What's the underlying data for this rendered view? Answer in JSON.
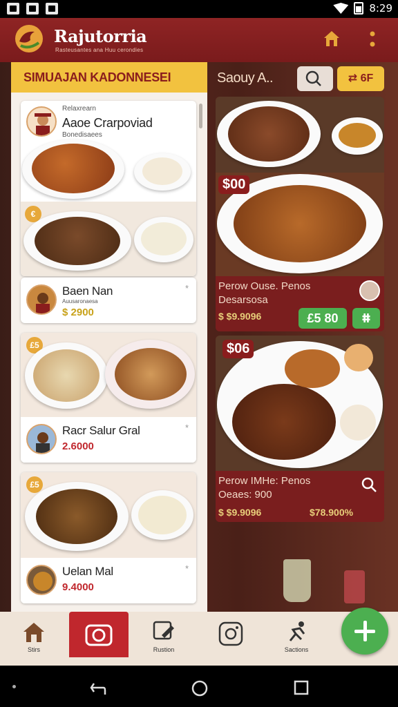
{
  "status": {
    "time": "8:29"
  },
  "app": {
    "title": "Rajutorria",
    "subtitle": "Rasteusantes ana Huu cerondies"
  },
  "left": {
    "header": "SIMUAJAN KADONNESEI",
    "cards": [
      {
        "tag": "Relaxrearn",
        "name": "Aaoe Crarpoviad",
        "desc": "Bonedisaees"
      },
      {
        "name": "Baen Nan",
        "desc": "Auusaronaesa",
        "price": "$ 2900",
        "badge": "€"
      },
      {
        "name": "Racr Salur Gral",
        "price": "2.6000",
        "badge": "£5"
      },
      {
        "name": "Uelan Mal",
        "price": "9.4000",
        "badge": "£5"
      }
    ],
    "star": "*"
  },
  "right": {
    "title": "Saouy A..",
    "filter_label": "6F",
    "cards": [
      {
        "num": "$00",
        "line1": "Perow   Ouse. Penos",
        "line2": "Desarsosa",
        "price": "$ $9.9096",
        "pill1": "£5 80",
        "pill2": "ⵌ"
      },
      {
        "num": "$06",
        "line1": "Perow   IMHe: Penos",
        "line2": "Oeaes: 900",
        "price1": "$ $9.9096",
        "price2": "$78.900%"
      }
    ]
  },
  "nav": {
    "items": [
      {
        "label": "Stirs"
      },
      {
        "label": ""
      },
      {
        "label": "Rustion"
      },
      {
        "label": ""
      },
      {
        "label": "Sactions"
      }
    ]
  },
  "colors": {
    "brand": "#8a1d1d",
    "accent": "#f2c23f",
    "green": "#4caf50"
  }
}
